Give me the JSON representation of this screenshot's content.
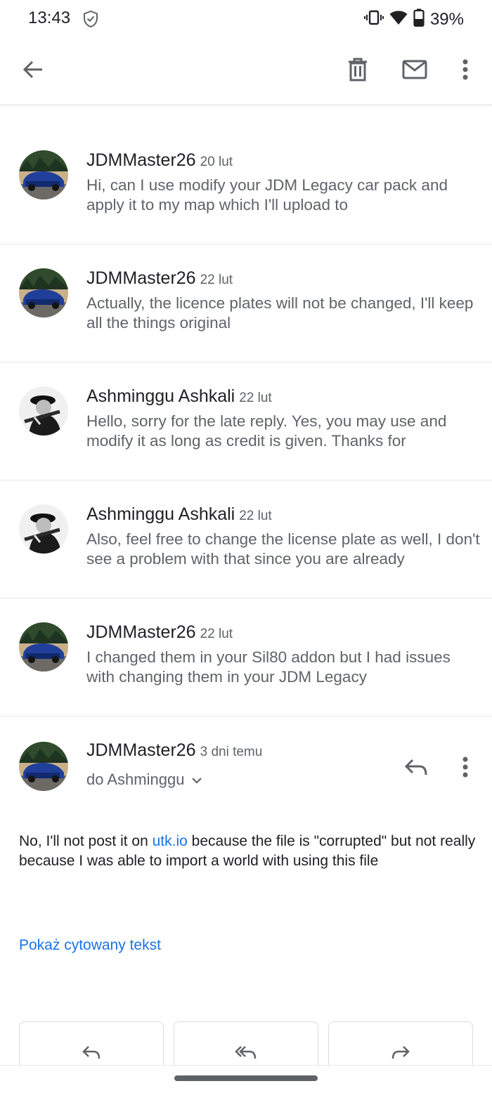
{
  "status_bar": {
    "time": "13:43",
    "battery": "39%",
    "icons": [
      "shield-icon",
      "vibrate-icon",
      "wifi-icon",
      "battery-icon"
    ]
  },
  "app_bar": {
    "icons": [
      "back-arrow-icon",
      "trash-icon",
      "mail-icon",
      "more-vert-icon"
    ]
  },
  "messages": [
    {
      "sender": "JDMMaster26",
      "date": "20 lut",
      "snippet": "Hi, can I use modify your JDM Legacy car pack and apply it to my map which I'll upload to",
      "avatar": "car"
    },
    {
      "sender": "JDMMaster26",
      "date": "22 lut",
      "snippet": "Actually, the licence plates will not be changed, I'll keep all the things original",
      "avatar": "car"
    },
    {
      "sender": "Ashminggu Ashkali",
      "date": "22 lut",
      "snippet": "Hello, sorry for the late reply. Yes, you may use and modify it as long as credit is given. Thanks for",
      "avatar": "person"
    },
    {
      "sender": "Ashminggu Ashkali",
      "date": "22 lut",
      "snippet": "Also, feel free to change the license plate as well, I don't see a problem with that since you are already",
      "avatar": "person"
    },
    {
      "sender": "JDMMaster26",
      "date": "22 lut",
      "snippet": "I changed them in your Sil80 addon but I had issues with changing them in your JDM Legacy",
      "avatar": "car"
    }
  ],
  "expanded_message": {
    "sender": "JDMMaster26",
    "date": "3 dni temu",
    "to": "do Ashminggu",
    "body_before_link": "No, I'll not post it on ",
    "link_text": "utk.io",
    "body_after_link": " because the file is \"corrupted\" but not really because I was able to import a world with using this file",
    "show_quoted": "Pokaż cytowany tekst"
  },
  "action_buttons": [
    "reply-icon",
    "reply-all-icon",
    "forward-icon"
  ],
  "colors": {
    "accent": "#1a73e8",
    "text_primary": "#202124",
    "text_secondary": "#5f6368",
    "divider": "#e6e6e6"
  }
}
